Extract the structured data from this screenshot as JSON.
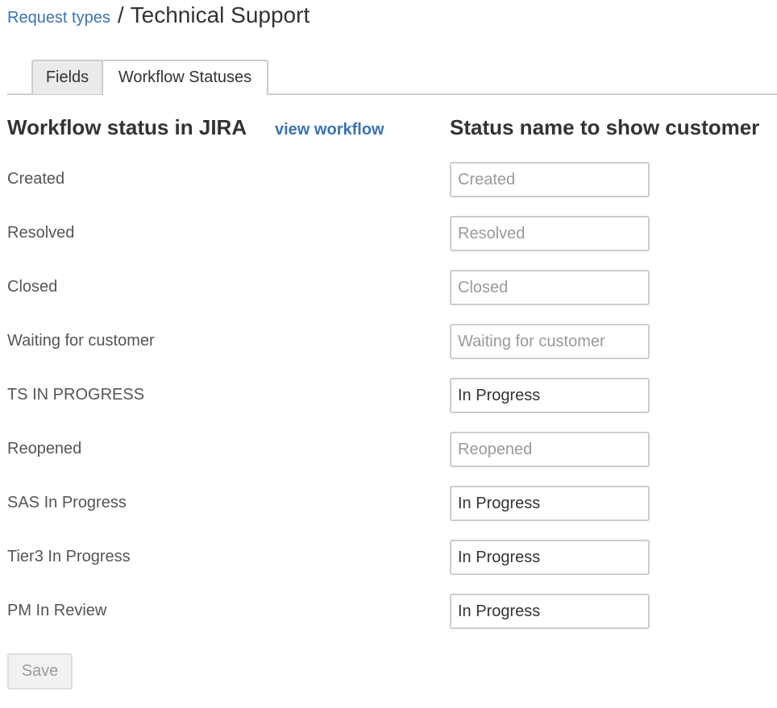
{
  "breadcrumb": {
    "parent_label": "Request types",
    "separator": "/",
    "title": "Technical Support"
  },
  "tabs": [
    {
      "label": "Fields",
      "active": false
    },
    {
      "label": "Workflow Statuses",
      "active": true
    }
  ],
  "columns": {
    "left_heading": "Workflow status in JIRA",
    "view_workflow_link": "view workflow",
    "right_heading": "Status name to show customer"
  },
  "statuses": [
    {
      "jira_status": "Created",
      "customer_value": "",
      "placeholder": "Created"
    },
    {
      "jira_status": "Resolved",
      "customer_value": "",
      "placeholder": "Resolved"
    },
    {
      "jira_status": "Closed",
      "customer_value": "",
      "placeholder": "Closed"
    },
    {
      "jira_status": "Waiting for customer",
      "customer_value": "",
      "placeholder": "Waiting for customer"
    },
    {
      "jira_status": "TS IN PROGRESS",
      "customer_value": "In Progress",
      "placeholder": ""
    },
    {
      "jira_status": "Reopened",
      "customer_value": "",
      "placeholder": "Reopened"
    },
    {
      "jira_status": "SAS In Progress",
      "customer_value": "In Progress",
      "placeholder": ""
    },
    {
      "jira_status": "Tier3 In Progress",
      "customer_value": "In Progress",
      "placeholder": ""
    },
    {
      "jira_status": "PM In Review",
      "customer_value": "In Progress",
      "placeholder": ""
    }
  ],
  "actions": {
    "save_label": "Save",
    "save_enabled": false
  },
  "colors": {
    "link": "#3b73af",
    "border": "#cccccc",
    "placeholder": "#999999"
  }
}
